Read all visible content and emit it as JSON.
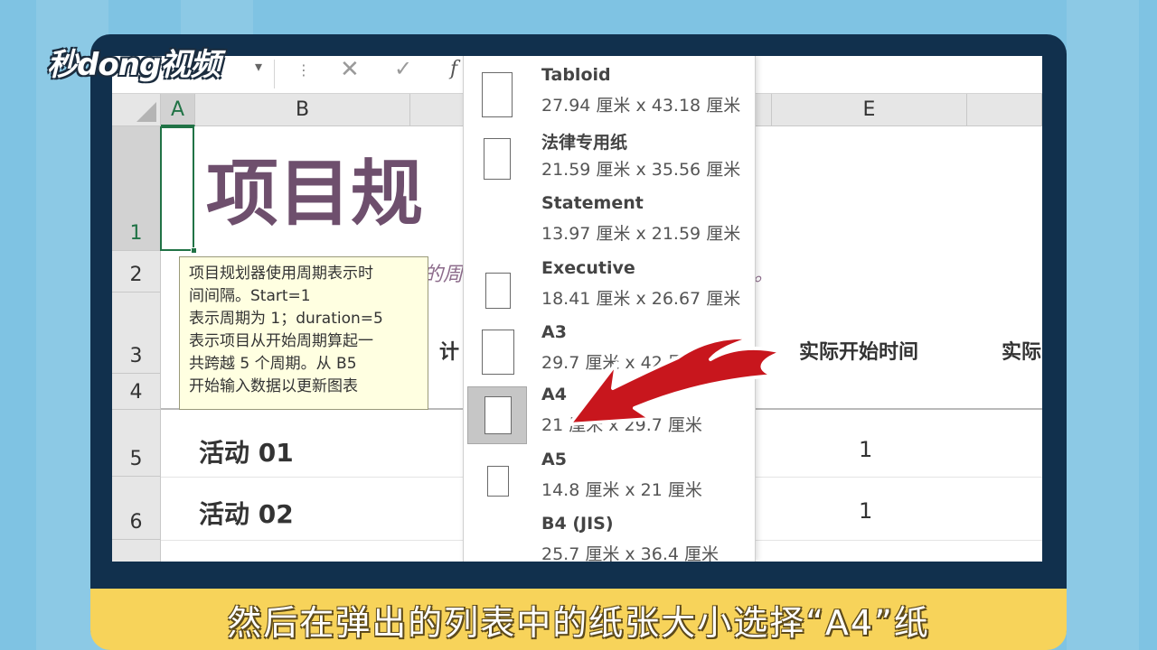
{
  "logo": {
    "text": "秒dong视频"
  },
  "formula_bar": {
    "chevron": "▾",
    "dots": "⋮",
    "cancel": "✕",
    "confirm": "✓",
    "fx": "f"
  },
  "columns": {
    "a": "A",
    "b": "B",
    "e": "E"
  },
  "rows": [
    "1",
    "2",
    "3",
    "4",
    "5",
    "6"
  ],
  "sheet": {
    "title_fragment": "项目规",
    "subtitle_fragment_left": "的周",
    "subtitle_fragment_right": "。",
    "header_fragment": "计",
    "header_actual_start": "实际开始时间",
    "header_actual_fragment": "实际",
    "activities": [
      {
        "name": "活动 01",
        "value": "1"
      },
      {
        "name": "活动 02",
        "value": "1"
      }
    ]
  },
  "tooltip": {
    "lines": [
      "项目规划器使用周期表示时",
      "间间隔。Start=1",
      "表示周期为 1；duration=5",
      "表示项目从开始周期算起一",
      "共跨越 5 个周期。从 B5",
      "开始输入数据以更新图表"
    ]
  },
  "paper_sizes": [
    {
      "name": "Tabloid",
      "size": "27.94 厘米 x 43.18 厘米",
      "selected": false
    },
    {
      "name": "法律专用纸",
      "size": "21.59 厘米 x 35.56 厘米",
      "selected": false
    },
    {
      "name": "Statement",
      "size": "13.97 厘米 x 21.59 厘米",
      "selected": false
    },
    {
      "name": "Executive",
      "size": "18.41 厘米 x 26.67 厘米",
      "selected": false
    },
    {
      "name": "A3",
      "size": "29.7 厘米 x 42 厘米",
      "selected": false
    },
    {
      "name": "A4",
      "size": "21 厘米 x 29.7 厘米",
      "selected": true
    },
    {
      "name": "A5",
      "size": "14.8 厘米 x 21 厘米",
      "selected": false
    },
    {
      "name": "B4 (JIS)",
      "size": "25.7 厘米 x 36.4 厘米",
      "selected": false
    }
  ],
  "caption": {
    "text": "然后在弹出的列表中的纸张大小选择“A4”纸"
  },
  "colors": {
    "accent_green": "#217346",
    "title_purple": "#6e4f6d",
    "arrow_red": "#c8161d",
    "caption_yellow": "#f7d35a"
  }
}
